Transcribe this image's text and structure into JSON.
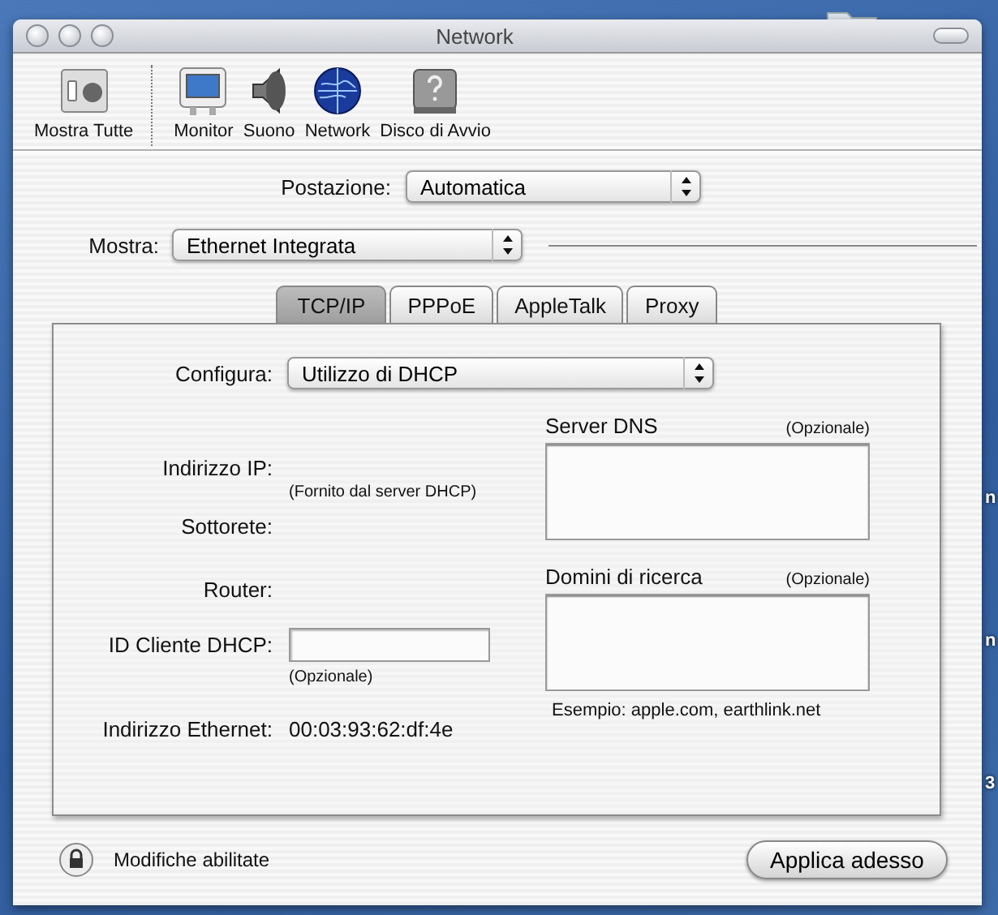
{
  "window": {
    "title": "Network"
  },
  "toolbar": {
    "items": [
      {
        "label": "Mostra Tutte",
        "kind": "all"
      },
      {
        "label": "Monitor",
        "kind": "monitor"
      },
      {
        "label": "Suono",
        "kind": "sound"
      },
      {
        "label": "Network",
        "kind": "network"
      },
      {
        "label": "Disco di Avvio",
        "kind": "disk"
      }
    ]
  },
  "location": {
    "label": "Postazione:",
    "value": "Automatica"
  },
  "show": {
    "label": "Mostra:",
    "value": "Ethernet Integrata"
  },
  "tabs": [
    {
      "label": "TCP/IP",
      "selected": true
    },
    {
      "label": "PPPoE",
      "selected": false
    },
    {
      "label": "AppleTalk",
      "selected": false
    },
    {
      "label": "Proxy",
      "selected": false
    }
  ],
  "configure": {
    "label": "Configura:",
    "value": "Utilizzo di DHCP"
  },
  "fields": [
    {
      "kind": "label",
      "label": "Indirizzo IP:"
    },
    {
      "kind": "hint",
      "text": "(Fornito dal server DHCP)"
    },
    {
      "kind": "label",
      "label": "Sottorete:"
    },
    {
      "kind": "label",
      "label": "Router:"
    },
    {
      "kind": "input",
      "label": "ID Cliente DHCP:"
    },
    {
      "kind": "hint",
      "text": "(Opzionale)"
    },
    {
      "kind": "value",
      "label": "Indirizzo Ethernet:",
      "value": "00:03:93:62:df:4e"
    }
  ],
  "dns": {
    "title": "Server DNS",
    "note": "(Opzionale)"
  },
  "search_domains": {
    "title": "Domini di ricerca",
    "note": "(Opzionale)",
    "example": "Esempio: apple.com, earthlink.net"
  },
  "lock": {
    "label": "Modifiche abilitate"
  },
  "apply_button": "Applica adesso",
  "desktop_labels": [
    "n",
    "n",
    "3"
  ]
}
